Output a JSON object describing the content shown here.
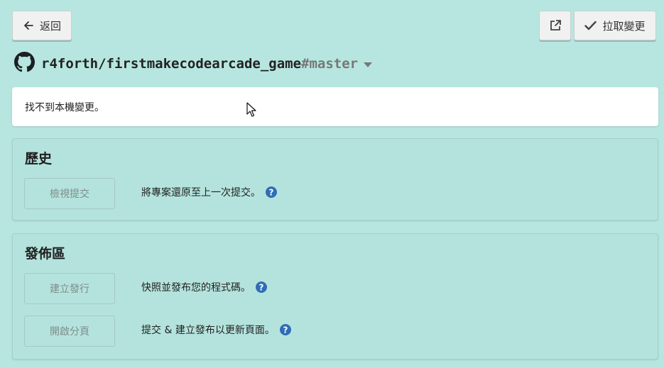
{
  "header": {
    "back_label": "返回",
    "pull_label": "拉取變更"
  },
  "repo": {
    "name": "r4forth/firstmakecodearcade_game",
    "branch": "#master"
  },
  "status": {
    "message": "找不到本機變更。"
  },
  "history": {
    "title": "歷史",
    "view_commits_label": "檢視提交",
    "view_commits_desc": "將專案還原至上一次提交。"
  },
  "release": {
    "title": "發佈區",
    "create_release_label": "建立發行",
    "create_release_desc": "快照並發布您的程式碼。",
    "open_branch_label": "開啟分頁",
    "open_branch_desc": "提交 & 建立發布以更新頁面。"
  },
  "colors": {
    "background": "#b7e6e0",
    "help_icon": "#2f6db5"
  },
  "icons": [
    "arrow-left-icon",
    "external-link-icon",
    "check-icon",
    "github-icon",
    "caret-down-icon",
    "help-icon",
    "mouse-pointer-icon"
  ]
}
